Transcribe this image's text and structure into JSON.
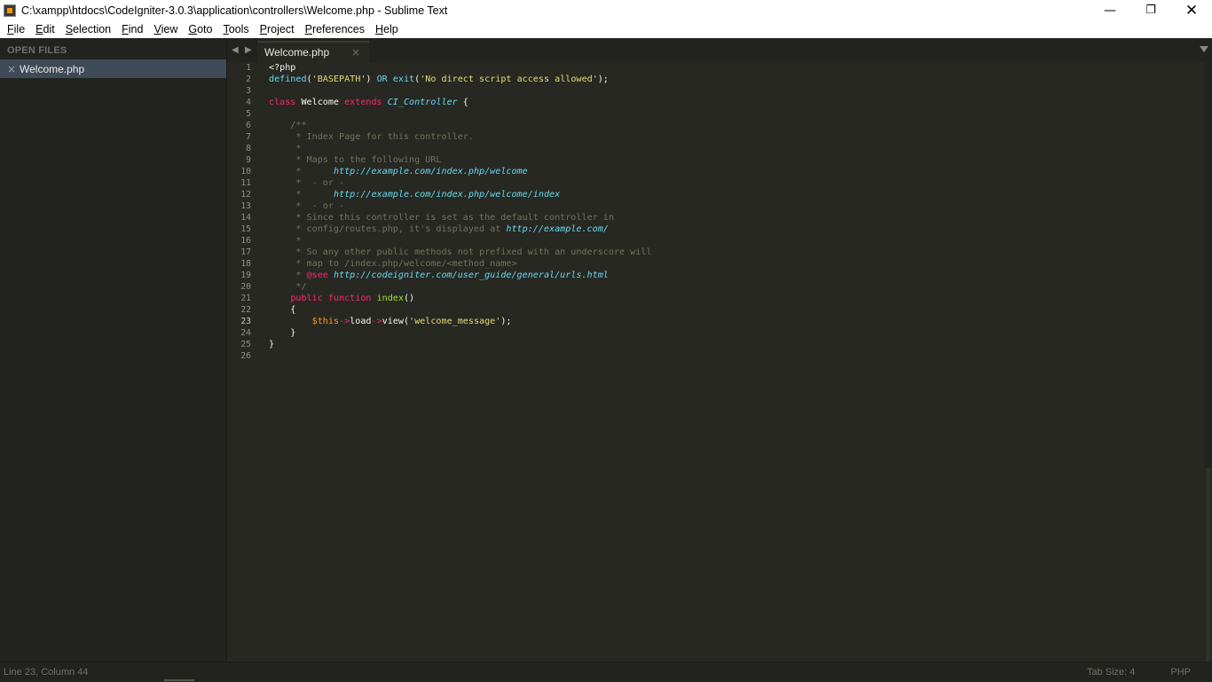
{
  "window": {
    "title": "C:\\xampp\\htdocs\\CodeIgniter-3.0.3\\application\\controllers\\Welcome.php - Sublime Text",
    "minimize_icon": "minimize-icon",
    "maximize_icon": "restore-icon",
    "close_icon": "close-icon"
  },
  "menu": {
    "items": [
      "File",
      "Edit",
      "Selection",
      "Find",
      "View",
      "Goto",
      "Tools",
      "Project",
      "Preferences",
      "Help"
    ]
  },
  "sidebar": {
    "header": "OPEN FILES",
    "files": [
      {
        "name": "Welcome.php",
        "close_glyph": "×"
      }
    ]
  },
  "tabs": {
    "items": [
      {
        "label": "Welcome.php",
        "close_glyph": "×"
      }
    ],
    "nav_prev": "◀",
    "nav_next": "▶"
  },
  "editor": {
    "active_line": 23,
    "line_numbers": [
      "1",
      "2",
      "3",
      "4",
      "5",
      "6",
      "7",
      "8",
      "9",
      "10",
      "11",
      "12",
      "13",
      "14",
      "15",
      "16",
      "17",
      "18",
      "19",
      "20",
      "21",
      "22",
      "23",
      "24",
      "25",
      "26"
    ],
    "lines": [
      [
        {
          "t": "<?php",
          "c": "c-default"
        }
      ],
      [
        {
          "t": "defined",
          "c": "c-blue"
        },
        {
          "t": "(",
          "c": "c-default"
        },
        {
          "t": "'BASEPATH'",
          "c": "c-str"
        },
        {
          "t": ") ",
          "c": "c-default"
        },
        {
          "t": "OR",
          "c": "c-cls"
        },
        {
          "t": " ",
          "c": "c-default"
        },
        {
          "t": "exit",
          "c": "c-blue"
        },
        {
          "t": "(",
          "c": "c-default"
        },
        {
          "t": "'No direct script access allowed'",
          "c": "c-str"
        },
        {
          "t": ");",
          "c": "c-default"
        }
      ],
      [],
      [
        {
          "t": "class",
          "c": "c-kw"
        },
        {
          "t": " Welcome ",
          "c": "c-default"
        },
        {
          "t": "extends",
          "c": "c-kw"
        },
        {
          "t": " ",
          "c": "c-default"
        },
        {
          "t": "CI_Controller",
          "c": "c-url"
        },
        {
          "t": " {",
          "c": "c-default"
        }
      ],
      [],
      [
        {
          "t": "    /**",
          "c": "c-cmt"
        }
      ],
      [
        {
          "t": "     * Index Page for this controller.",
          "c": "c-cmt"
        }
      ],
      [
        {
          "t": "     *",
          "c": "c-cmt"
        }
      ],
      [
        {
          "t": "     * Maps to the following URL",
          "c": "c-cmt"
        }
      ],
      [
        {
          "t": "     *      ",
          "c": "c-cmt"
        },
        {
          "t": "http://example.com/index.php/welcome",
          "c": "c-url"
        }
      ],
      [
        {
          "t": "     *  - or -",
          "c": "c-cmt"
        }
      ],
      [
        {
          "t": "     *      ",
          "c": "c-cmt"
        },
        {
          "t": "http://example.com/index.php/welcome/index",
          "c": "c-url"
        }
      ],
      [
        {
          "t": "     *  - or -",
          "c": "c-cmt"
        }
      ],
      [
        {
          "t": "     * Since this controller is set as the default controller in",
          "c": "c-cmt"
        }
      ],
      [
        {
          "t": "     * config/routes.php, it's displayed at ",
          "c": "c-cmt"
        },
        {
          "t": "http://example.com/",
          "c": "c-url"
        }
      ],
      [
        {
          "t": "     *",
          "c": "c-cmt"
        }
      ],
      [
        {
          "t": "     * So any other public methods not prefixed with an underscore will",
          "c": "c-cmt"
        }
      ],
      [
        {
          "t": "     * map to /index.php/welcome/<method_name>",
          "c": "c-cmt"
        }
      ],
      [
        {
          "t": "     * ",
          "c": "c-cmt"
        },
        {
          "t": "@see",
          "c": "c-kw"
        },
        {
          "t": " ",
          "c": "c-cmt"
        },
        {
          "t": "http://codeigniter.com/user_guide/general/urls.html",
          "c": "c-url"
        }
      ],
      [
        {
          "t": "     */",
          "c": "c-cmt"
        }
      ],
      [
        {
          "t": "    ",
          "c": "c-default"
        },
        {
          "t": "public",
          "c": "c-kw"
        },
        {
          "t": " ",
          "c": "c-default"
        },
        {
          "t": "function",
          "c": "c-kw"
        },
        {
          "t": " ",
          "c": "c-default"
        },
        {
          "t": "index",
          "c": "c-fn"
        },
        {
          "t": "()",
          "c": "c-default"
        }
      ],
      [
        {
          "t": "    {",
          "c": "c-default"
        }
      ],
      [
        {
          "t": "        ",
          "c": "c-default"
        },
        {
          "t": "$this",
          "c": "c-orange"
        },
        {
          "t": "->",
          "c": "c-kw"
        },
        {
          "t": "load",
          "c": "c-default"
        },
        {
          "t": "->",
          "c": "c-kw"
        },
        {
          "t": "view(",
          "c": "c-default"
        },
        {
          "t": "'welcome_message'",
          "c": "c-str"
        },
        {
          "t": ");",
          "c": "c-default"
        }
      ],
      [
        {
          "t": "    }",
          "c": "c-default"
        }
      ],
      [
        {
          "t": "}",
          "c": "c-default"
        }
      ],
      []
    ]
  },
  "status": {
    "position": "Line 23, Column 44",
    "tab_size": "Tab Size: 4",
    "syntax": "PHP"
  },
  "colors": {
    "background": "#272822",
    "sidebar": "#22231e",
    "selected_file": "#3f4a57",
    "keyword": "#f92672",
    "string": "#e6db74",
    "comment": "#75715e",
    "type": "#66d9ef"
  }
}
